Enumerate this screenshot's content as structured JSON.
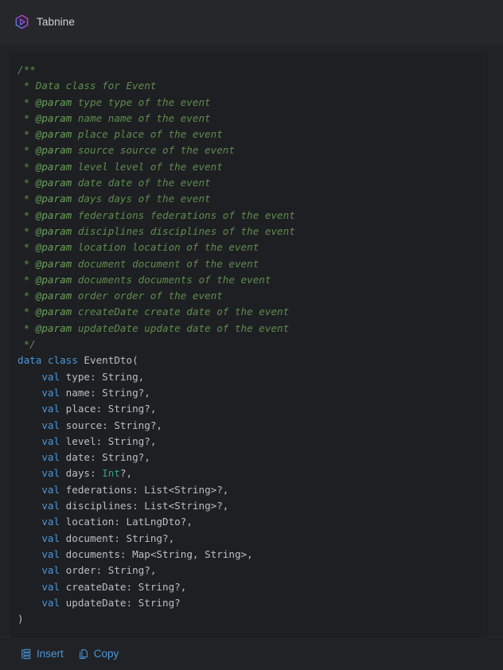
{
  "header": {
    "brand_label": "Tabnine",
    "logo_icon": "tabnine-hexagon-logo-icon",
    "logo_colors": {
      "start": "#8a4fd8",
      "mid": "#b23fd0",
      "end": "#4a7fe0"
    }
  },
  "colors": {
    "app_background": "#212226",
    "header_background": "#26272b",
    "code_background": "#1e1f22",
    "text_primary": "#cfd2d6",
    "code_default": "#bcbec4",
    "comment": "#5f8c4f",
    "keyword": "#4b96d8",
    "builtin_type": "#3a9e8e",
    "action_link": "#4b96d8",
    "divider": "#2b2d31"
  },
  "code": {
    "language": "kotlin",
    "lines": [
      {
        "id": "l1",
        "tokens": [
          {
            "t": "/**",
            "k": "comment"
          }
        ]
      },
      {
        "id": "l2",
        "tokens": [
          {
            "t": " * Data class for Event",
            "k": "comment"
          }
        ]
      },
      {
        "id": "l3",
        "tokens": [
          {
            "t": " * ",
            "k": "comment"
          },
          {
            "t": "@param",
            "k": "doctag"
          },
          {
            "t": " type type of the event",
            "k": "comment"
          }
        ]
      },
      {
        "id": "l4",
        "tokens": [
          {
            "t": " * ",
            "k": "comment"
          },
          {
            "t": "@param",
            "k": "doctag"
          },
          {
            "t": " name name of the event",
            "k": "comment"
          }
        ]
      },
      {
        "id": "l5",
        "tokens": [
          {
            "t": " * ",
            "k": "comment"
          },
          {
            "t": "@param",
            "k": "doctag"
          },
          {
            "t": " place place of the event",
            "k": "comment"
          }
        ]
      },
      {
        "id": "l6",
        "tokens": [
          {
            "t": " * ",
            "k": "comment"
          },
          {
            "t": "@param",
            "k": "doctag"
          },
          {
            "t": " source source of the event",
            "k": "comment"
          }
        ]
      },
      {
        "id": "l7",
        "tokens": [
          {
            "t": " * ",
            "k": "comment"
          },
          {
            "t": "@param",
            "k": "doctag"
          },
          {
            "t": " level level of the event",
            "k": "comment"
          }
        ]
      },
      {
        "id": "l8",
        "tokens": [
          {
            "t": " * ",
            "k": "comment"
          },
          {
            "t": "@param",
            "k": "doctag"
          },
          {
            "t": " date date of the event",
            "k": "comment"
          }
        ]
      },
      {
        "id": "l9",
        "tokens": [
          {
            "t": " * ",
            "k": "comment"
          },
          {
            "t": "@param",
            "k": "doctag"
          },
          {
            "t": " days days of the event",
            "k": "comment"
          }
        ]
      },
      {
        "id": "l10",
        "tokens": [
          {
            "t": " * ",
            "k": "comment"
          },
          {
            "t": "@param",
            "k": "doctag"
          },
          {
            "t": " federations federations of the event",
            "k": "comment"
          }
        ]
      },
      {
        "id": "l11",
        "tokens": [
          {
            "t": " * ",
            "k": "comment"
          },
          {
            "t": "@param",
            "k": "doctag"
          },
          {
            "t": " disciplines disciplines of the event",
            "k": "comment"
          }
        ]
      },
      {
        "id": "l12",
        "tokens": [
          {
            "t": " * ",
            "k": "comment"
          },
          {
            "t": "@param",
            "k": "doctag"
          },
          {
            "t": " location location of the event",
            "k": "comment"
          }
        ]
      },
      {
        "id": "l13",
        "tokens": [
          {
            "t": " * ",
            "k": "comment"
          },
          {
            "t": "@param",
            "k": "doctag"
          },
          {
            "t": " document document of the event",
            "k": "comment"
          }
        ]
      },
      {
        "id": "l14",
        "tokens": [
          {
            "t": " * ",
            "k": "comment"
          },
          {
            "t": "@param",
            "k": "doctag"
          },
          {
            "t": " documents documents of the event",
            "k": "comment"
          }
        ]
      },
      {
        "id": "l15",
        "tokens": [
          {
            "t": " * ",
            "k": "comment"
          },
          {
            "t": "@param",
            "k": "doctag"
          },
          {
            "t": " order order of the event",
            "k": "comment"
          }
        ]
      },
      {
        "id": "l16",
        "tokens": [
          {
            "t": " * ",
            "k": "comment"
          },
          {
            "t": "@param",
            "k": "doctag"
          },
          {
            "t": " createDate create date of the event",
            "k": "comment"
          }
        ]
      },
      {
        "id": "l17",
        "tokens": [
          {
            "t": " * ",
            "k": "comment"
          },
          {
            "t": "@param",
            "k": "doctag"
          },
          {
            "t": " updateDate update date of the event",
            "k": "comment"
          }
        ]
      },
      {
        "id": "l18",
        "tokens": [
          {
            "t": " */",
            "k": "comment"
          }
        ]
      },
      {
        "id": "l19",
        "tokens": [
          {
            "t": "data class",
            "k": "kw"
          },
          {
            "t": " EventDto(",
            "k": "ident"
          }
        ]
      },
      {
        "id": "l20",
        "tokens": [
          {
            "t": "    ",
            "k": "punct"
          },
          {
            "t": "val",
            "k": "kw"
          },
          {
            "t": " type: String,",
            "k": "ident"
          }
        ]
      },
      {
        "id": "l21",
        "tokens": [
          {
            "t": "    ",
            "k": "punct"
          },
          {
            "t": "val",
            "k": "kw"
          },
          {
            "t": " name: String?,",
            "k": "ident"
          }
        ]
      },
      {
        "id": "l22",
        "tokens": [
          {
            "t": "    ",
            "k": "punct"
          },
          {
            "t": "val",
            "k": "kw"
          },
          {
            "t": " place: String?,",
            "k": "ident"
          }
        ]
      },
      {
        "id": "l23",
        "tokens": [
          {
            "t": "    ",
            "k": "punct"
          },
          {
            "t": "val",
            "k": "kw"
          },
          {
            "t": " source: String?,",
            "k": "ident"
          }
        ]
      },
      {
        "id": "l24",
        "tokens": [
          {
            "t": "    ",
            "k": "punct"
          },
          {
            "t": "val",
            "k": "kw"
          },
          {
            "t": " level: String?,",
            "k": "ident"
          }
        ]
      },
      {
        "id": "l25",
        "tokens": [
          {
            "t": "    ",
            "k": "punct"
          },
          {
            "t": "val",
            "k": "kw"
          },
          {
            "t": " date: String?,",
            "k": "ident"
          }
        ]
      },
      {
        "id": "l26",
        "tokens": [
          {
            "t": "    ",
            "k": "punct"
          },
          {
            "t": "val",
            "k": "kw"
          },
          {
            "t": " days: ",
            "k": "ident"
          },
          {
            "t": "Int",
            "k": "numtype"
          },
          {
            "t": "?,",
            "k": "ident"
          }
        ]
      },
      {
        "id": "l27",
        "tokens": [
          {
            "t": "    ",
            "k": "punct"
          },
          {
            "t": "val",
            "k": "kw"
          },
          {
            "t": " federations: List<String>?,",
            "k": "ident"
          }
        ]
      },
      {
        "id": "l28",
        "tokens": [
          {
            "t": "    ",
            "k": "punct"
          },
          {
            "t": "val",
            "k": "kw"
          },
          {
            "t": " disciplines: List<String>?,",
            "k": "ident"
          }
        ]
      },
      {
        "id": "l29",
        "tokens": [
          {
            "t": "    ",
            "k": "punct"
          },
          {
            "t": "val",
            "k": "kw"
          },
          {
            "t": " location: LatLngDto?,",
            "k": "ident"
          }
        ]
      },
      {
        "id": "l30",
        "tokens": [
          {
            "t": "    ",
            "k": "punct"
          },
          {
            "t": "val",
            "k": "kw"
          },
          {
            "t": " document: String?,",
            "k": "ident"
          }
        ]
      },
      {
        "id": "l31",
        "tokens": [
          {
            "t": "    ",
            "k": "punct"
          },
          {
            "t": "val",
            "k": "kw"
          },
          {
            "t": " documents: Map<String, String>,",
            "k": "ident"
          }
        ]
      },
      {
        "id": "l32",
        "tokens": [
          {
            "t": "    ",
            "k": "punct"
          },
          {
            "t": "val",
            "k": "kw"
          },
          {
            "t": " order: String?,",
            "k": "ident"
          }
        ]
      },
      {
        "id": "l33",
        "tokens": [
          {
            "t": "    ",
            "k": "punct"
          },
          {
            "t": "val",
            "k": "kw"
          },
          {
            "t": " createDate: String?,",
            "k": "ident"
          }
        ]
      },
      {
        "id": "l34",
        "tokens": [
          {
            "t": "    ",
            "k": "punct"
          },
          {
            "t": "val",
            "k": "kw"
          },
          {
            "t": " updateDate: String?",
            "k": "ident"
          }
        ]
      },
      {
        "id": "l35",
        "tokens": [
          {
            "t": ")",
            "k": "ident"
          }
        ]
      }
    ]
  },
  "footer": {
    "actions": [
      {
        "id": "insert",
        "label": "Insert",
        "icon": "insert-code-icon"
      },
      {
        "id": "copy",
        "label": "Copy",
        "icon": "copy-icon"
      }
    ]
  }
}
